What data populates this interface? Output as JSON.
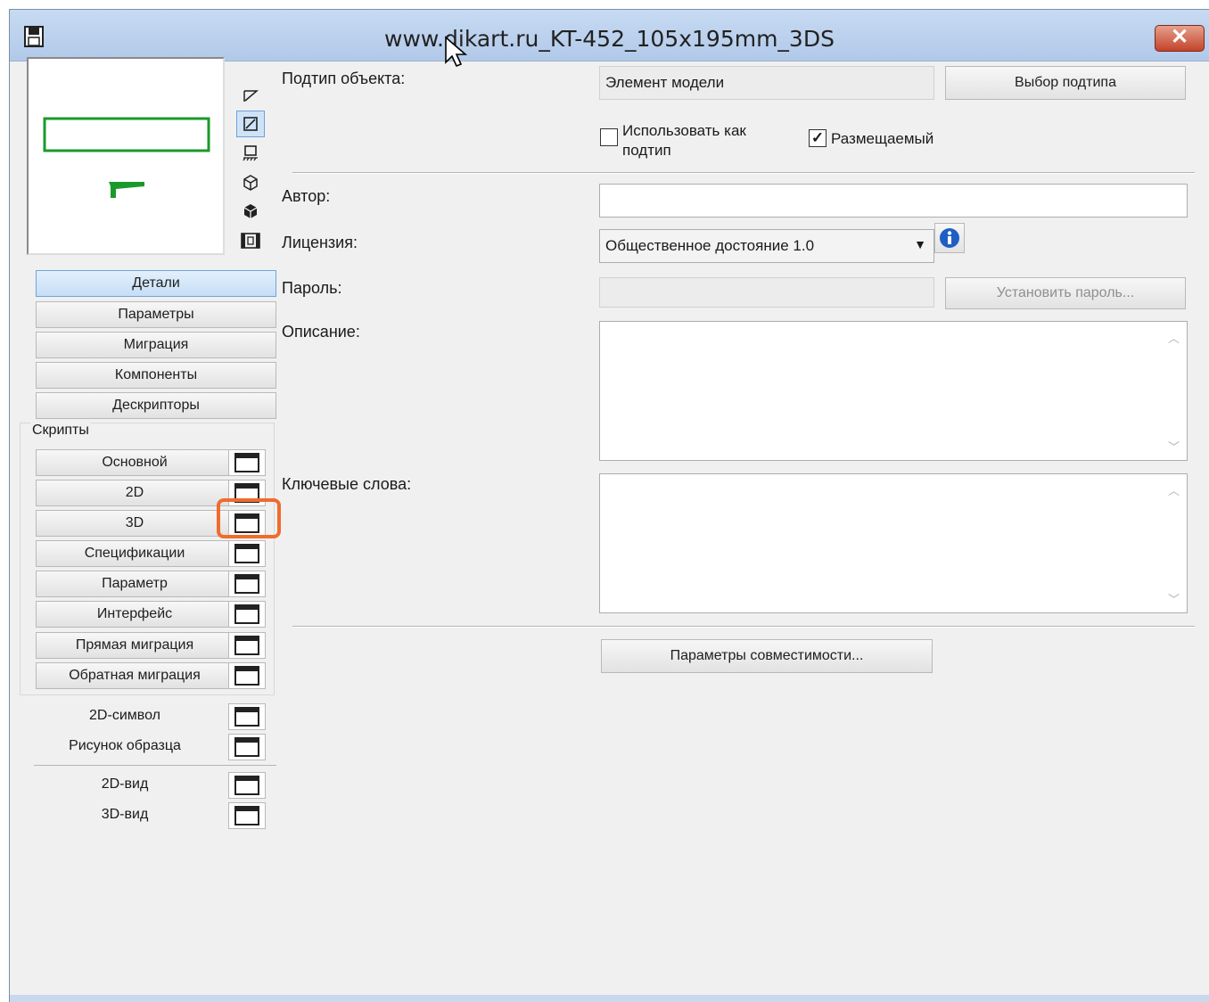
{
  "window": {
    "title": "www.dikart.ru_KT-452_105x195mm_3DS",
    "close_label": "✕"
  },
  "colors": {
    "highlight": "#ef6c2d",
    "preview_green": "#1a9a2a",
    "info_blue": "#1f5fc4"
  },
  "view_icons": [
    "floor-plan-view-icon",
    "2d-symbol-view-icon",
    "side-view-icon",
    "3d-wireframe-icon",
    "3d-solid-icon",
    "film-icon"
  ],
  "nav": {
    "items": [
      "Детали",
      "Параметры",
      "Миграция",
      "Компоненты",
      "Дескрипторы"
    ],
    "active": "Детали"
  },
  "scripts": {
    "group_label": "Скрипты",
    "items": [
      "Основной",
      "2D",
      "3D",
      "Спецификации",
      "Параметр",
      "Интерфейс",
      "Прямая миграция",
      "Обратная миграция"
    ],
    "highlighted": "3D"
  },
  "extras": {
    "symbol_2d": "2D-символ",
    "sample_image": "Рисунок образца",
    "view_2d": "2D-вид",
    "view_3d": "3D-вид"
  },
  "form": {
    "subtype_label": "Подтип объекта:",
    "subtype_value": "Элемент модели",
    "subtype_button": "Выбор подтипа",
    "use_as_subtype_label": "Использовать как подтип",
    "use_as_subtype_checked": false,
    "placeable_label": "Размещаемый",
    "placeable_checked": true,
    "author_label": "Автор:",
    "author_value": "",
    "license_label": "Лицензия:",
    "license_value": "Общественное достояние 1.0",
    "password_label": "Пароль:",
    "password_button": "Установить пароль...",
    "description_label": "Описание:",
    "description_value": "",
    "keywords_label": "Ключевые слова:",
    "keywords_value": "",
    "compat_button": "Параметры совместимости..."
  }
}
